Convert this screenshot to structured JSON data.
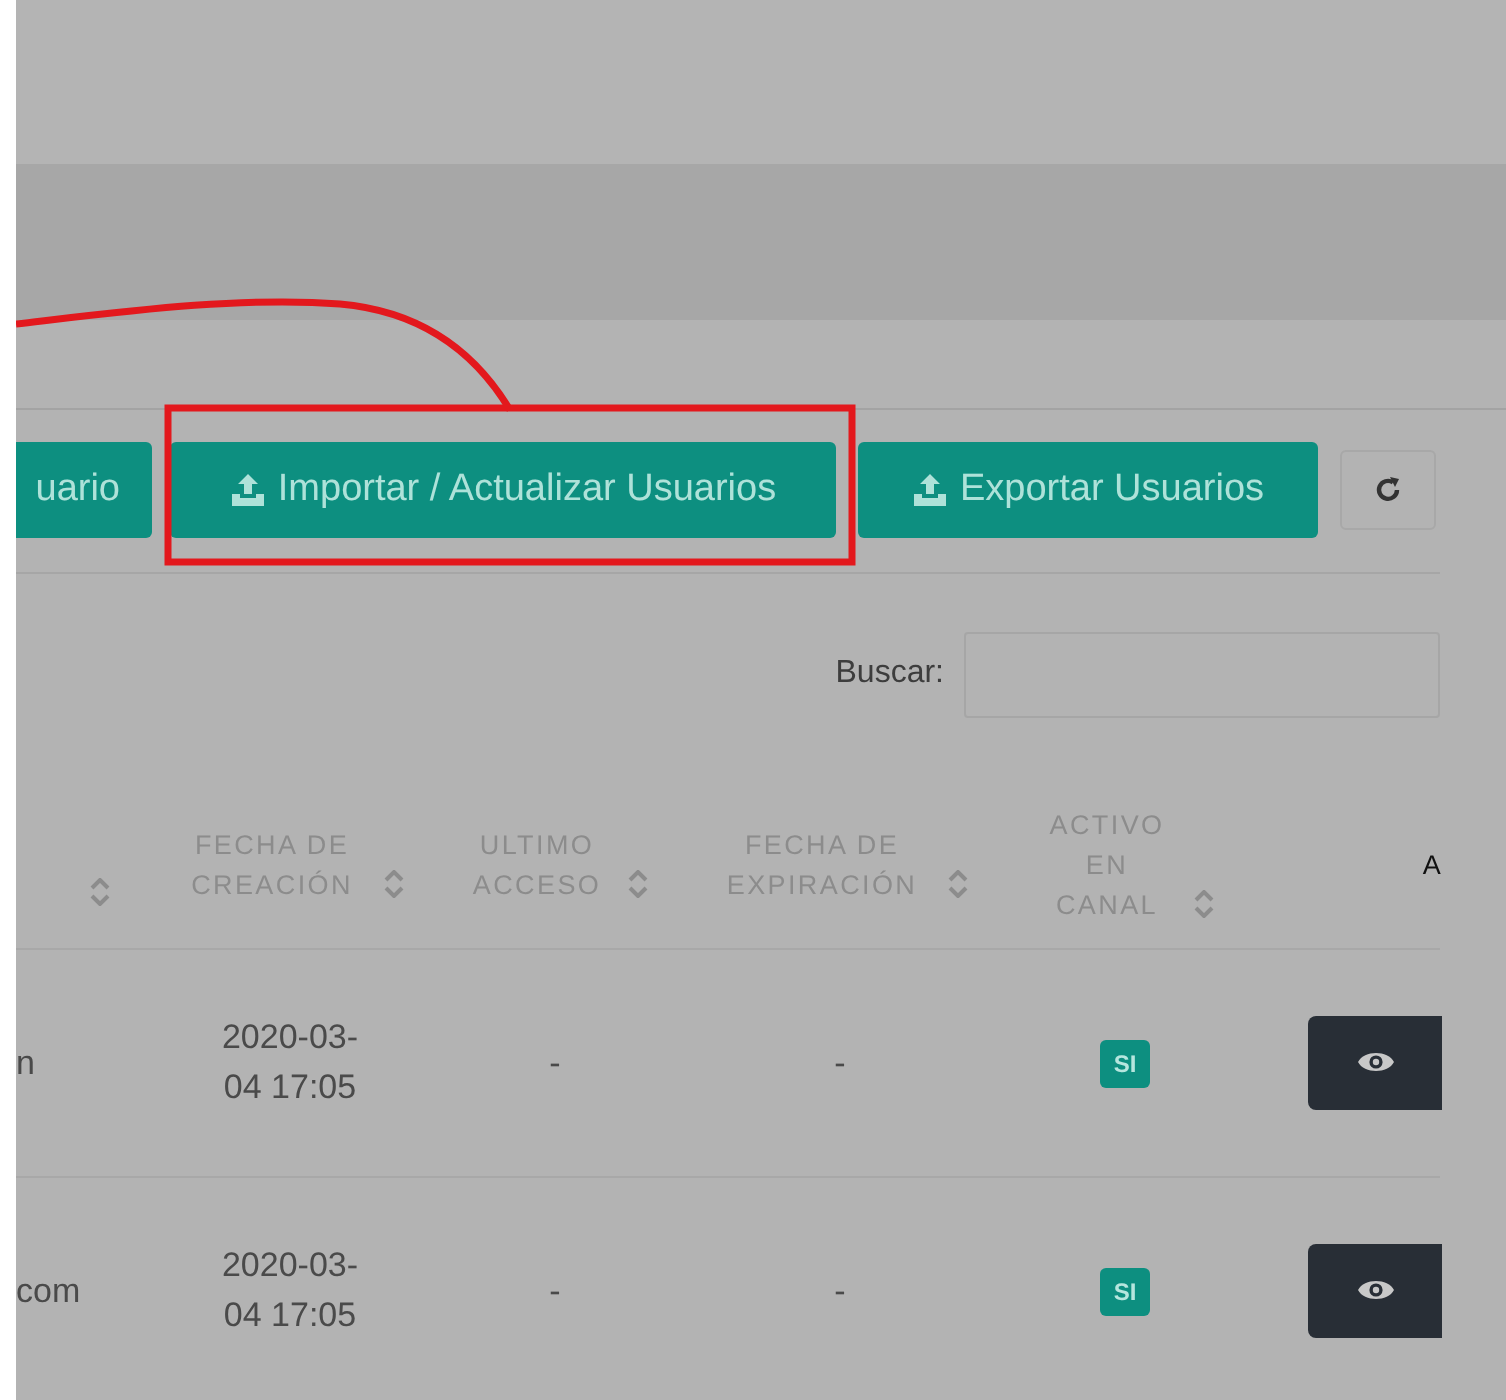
{
  "toolbar": {
    "buttons": [
      {
        "kind": "primary",
        "label": "uario"
      },
      {
        "kind": "upload",
        "label": "Importar / Actualizar Usuarios"
      },
      {
        "kind": "upload",
        "label": "Exportar Usuarios"
      },
      {
        "kind": "refresh"
      }
    ]
  },
  "search": {
    "label": "Buscar:"
  },
  "table": {
    "columns": [
      {
        "sortable": true
      },
      {
        "label": "FECHA DE CREACIÓN",
        "sortable": true
      },
      {
        "label": "ULTIMO ACCESO",
        "sortable": true
      },
      {
        "label": "FECHA DE EXPIRACIÓN",
        "sortable": true
      },
      {
        "label": "ACTIVO EN CANAL",
        "sortable": true
      },
      {
        "label": "A",
        "sortable": false
      }
    ],
    "rows": [
      {
        "email": "n",
        "created": "2020-03-04 17:05",
        "last_access": "-",
        "expiration": "-",
        "active": "SI"
      },
      {
        "email": "com",
        "created": "2020-03-04 17:05",
        "last_access": "-",
        "expiration": "-",
        "active": "SI"
      }
    ]
  }
}
